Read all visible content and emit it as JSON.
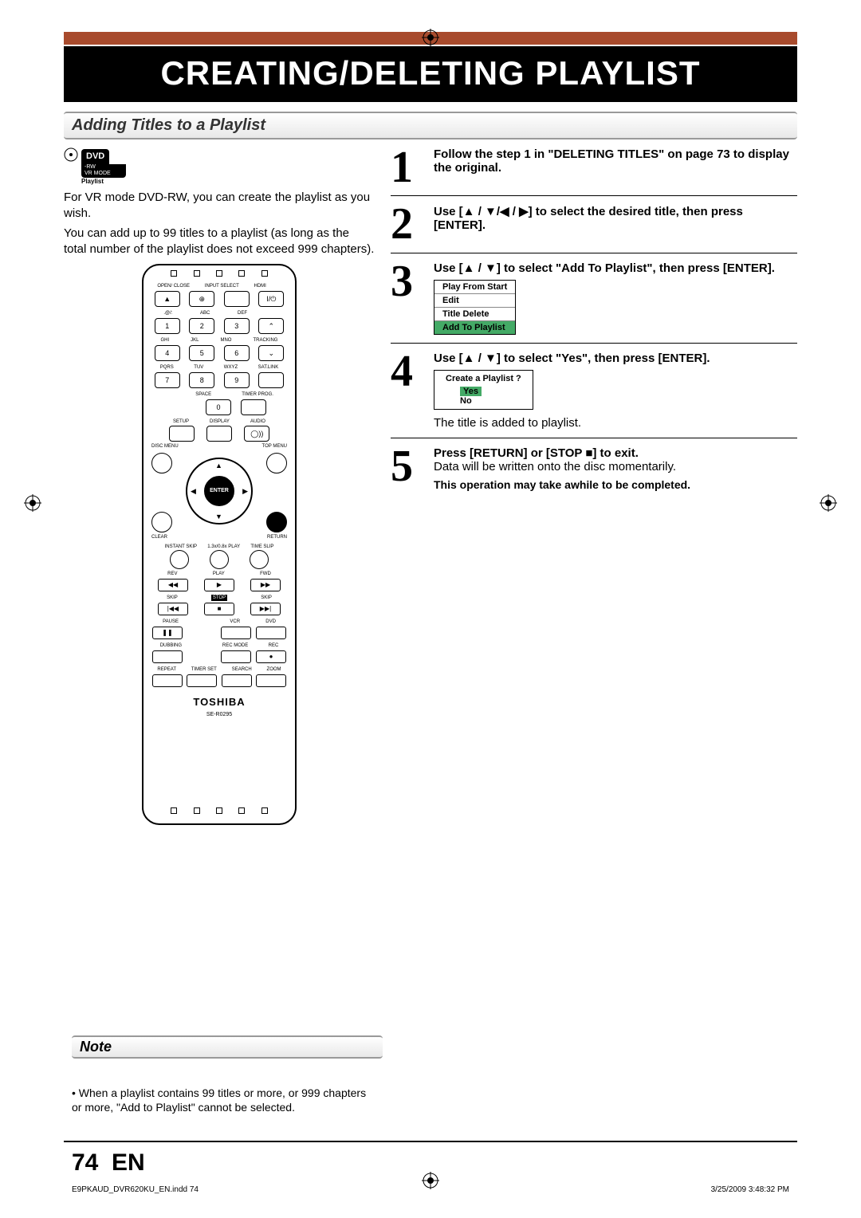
{
  "header": {
    "title": "CREATING/DELETING PLAYLIST"
  },
  "section": {
    "heading": "Adding Titles to a Playlist",
    "badge_main": "DVD",
    "badge_sub1": "-RW",
    "badge_sub2": "VR MODE",
    "badge_playlist": "Playlist",
    "intro1": "For VR mode DVD-RW, you can create the playlist as you wish.",
    "intro2": "You can add up to 99 titles to a playlist (as long as the total number of the playlist does not exceed 999 chapters)."
  },
  "remote": {
    "row1": [
      "OPEN/\nCLOSE",
      "INPUT\nSELECT",
      "HDMI",
      ""
    ],
    "numlabels1": [
      ".@/:",
      "ABC",
      "DEF",
      ""
    ],
    "numrow1": [
      "1",
      "2",
      "3",
      "⌃"
    ],
    "numlabels2": [
      "GHI",
      "JKL",
      "MNO",
      "TRACKING"
    ],
    "numrow2": [
      "4",
      "5",
      "6",
      "⌄"
    ],
    "numlabels3": [
      "PQRS",
      "TUV",
      "WXYZ",
      "SAT.LINK"
    ],
    "numrow3": [
      "7",
      "8",
      "9",
      ""
    ],
    "zero_lbl_l": "",
    "zero_lbl": "SPACE",
    "zero_lbl_r": "TIMER\nPROG.",
    "zero": "0",
    "setup_row_lbl": [
      "SETUP",
      "DISPLAY",
      "AUDIO"
    ],
    "discmenu": "DISC MENU",
    "topmenu": "TOP MENU",
    "enter": "ENTER",
    "clear": "CLEAR",
    "return": "RETURN",
    "midlabels": [
      "INSTANT\nSKIP",
      "1.3x/0.8x\nPLAY",
      "TIME SLIP"
    ],
    "revplayfwd_lbl": [
      "REV",
      "PLAY",
      "FWD"
    ],
    "revplayfwd": [
      "◀◀",
      "▶",
      "▶▶"
    ],
    "skipstop_lbl": [
      "SKIP",
      "STOP",
      "SKIP"
    ],
    "skipstop": [
      "|◀◀",
      "■",
      "▶▶|"
    ],
    "pause_lbl": [
      "PAUSE",
      "",
      "VCR",
      "DVD"
    ],
    "pause": [
      "❚❚",
      "",
      "",
      ""
    ],
    "dub_lbl": [
      "DUBBING",
      "",
      "REC MODE",
      "REC"
    ],
    "dub": [
      "",
      "",
      "",
      "●"
    ],
    "bottom_lbl": [
      "REPEAT",
      "TIMER SET",
      "SEARCH",
      "ZOOM"
    ],
    "brand": "TOSHIBA",
    "model": "SE-R0295"
  },
  "steps": [
    {
      "num": "1",
      "text": "Follow the step 1 in \"DELETING TITLES\" on page 73 to display the original."
    },
    {
      "num": "2",
      "text": "Use [▲ / ▼/◀ / ▶] to select the desired title, then press [ENTER]."
    },
    {
      "num": "3",
      "text": "Use [▲ / ▼] to select \"Add To Playlist\", then press [ENTER].",
      "menu": [
        "Play From Start",
        "Edit",
        "Title Delete",
        "Add To Playlist"
      ],
      "menu_selected": 3
    },
    {
      "num": "4",
      "text": "Use [▲ / ▼] to select \"Yes\", then press [ENTER].",
      "ask": {
        "q": "Create a Playlist ?",
        "yes": "Yes",
        "no": "No"
      },
      "after": "The title is added to playlist."
    },
    {
      "num": "5",
      "text": "Press [RETURN] or [STOP ■] to exit.",
      "sub": "Data will be written onto the disc momentarily.",
      "wait": "This operation may take awhile to be completed."
    }
  ],
  "note": {
    "heading": "Note",
    "body": "• When a playlist contains 99 titles or more, or 999 chapters or more, \"Add to Playlist\" cannot be selected."
  },
  "footer": {
    "page": "74",
    "lang": "EN",
    "left": "E9PKAUD_DVR620KU_EN.indd   74",
    "right": "3/25/2009   3:48:32 PM"
  }
}
